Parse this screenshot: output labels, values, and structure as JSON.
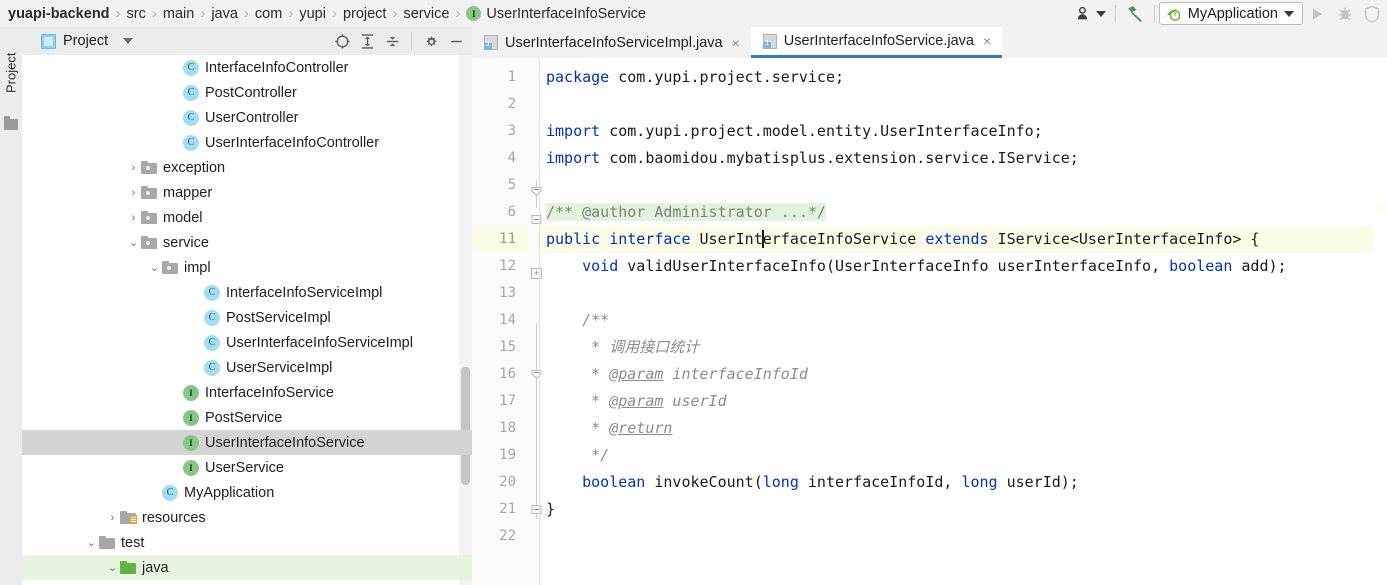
{
  "breadcrumb": {
    "root": "yuapi-backend",
    "items": [
      "src",
      "main",
      "java",
      "com",
      "yupi",
      "project",
      "service"
    ],
    "leaf": {
      "badge": "I",
      "label": "UserInterfaceInfoService"
    },
    "separator": "›"
  },
  "toolbar": {
    "user_icon": "user-icon",
    "build_icon": "hammer-icon",
    "run_config_label": "MyApplication",
    "run_icon": "run-icon",
    "debug_icon": "debug-icon",
    "coverage_icon": "coverage-icon"
  },
  "toolstrip": {
    "label": "Project",
    "folder_icon": "folder-icon"
  },
  "project_panel": {
    "title": "Project",
    "dropdown_icon": "chevron-down-icon",
    "tools": [
      "locate-icon",
      "expand-all-icon",
      "collapse-all-icon",
      "settings-gear-icon",
      "minimize-icon"
    ],
    "tree": [
      {
        "label": "InterfaceInfoController",
        "icon": "class",
        "indent": 7,
        "arrow": "",
        "state": ""
      },
      {
        "label": "PostController",
        "icon": "class",
        "indent": 7,
        "arrow": "",
        "state": ""
      },
      {
        "label": "UserController",
        "icon": "class",
        "indent": 7,
        "arrow": "",
        "state": ""
      },
      {
        "label": "UserInterfaceInfoController",
        "icon": "class",
        "indent": 7,
        "arrow": "",
        "state": ""
      },
      {
        "label": "exception",
        "icon": "folder",
        "indent": 5,
        "arrow": "collapsed",
        "state": ""
      },
      {
        "label": "mapper",
        "icon": "folder",
        "indent": 5,
        "arrow": "collapsed",
        "state": ""
      },
      {
        "label": "model",
        "icon": "folder",
        "indent": 5,
        "arrow": "collapsed",
        "state": ""
      },
      {
        "label": "service",
        "icon": "folder",
        "indent": 5,
        "arrow": "expanded",
        "state": ""
      },
      {
        "label": "impl",
        "icon": "folder",
        "indent": 6,
        "arrow": "expanded",
        "state": ""
      },
      {
        "label": "InterfaceInfoServiceImpl",
        "icon": "class",
        "indent": 8,
        "arrow": "",
        "state": ""
      },
      {
        "label": "PostServiceImpl",
        "icon": "class",
        "indent": 8,
        "arrow": "",
        "state": ""
      },
      {
        "label": "UserInterfaceInfoServiceImpl",
        "icon": "class",
        "indent": 8,
        "arrow": "",
        "state": ""
      },
      {
        "label": "UserServiceImpl",
        "icon": "class",
        "indent": 8,
        "arrow": "",
        "state": ""
      },
      {
        "label": "InterfaceInfoService",
        "icon": "iface",
        "indent": 7,
        "arrow": "",
        "state": ""
      },
      {
        "label": "PostService",
        "icon": "iface",
        "indent": 7,
        "arrow": "",
        "state": ""
      },
      {
        "label": "UserInterfaceInfoService",
        "icon": "iface",
        "indent": 7,
        "arrow": "",
        "state": "selected"
      },
      {
        "label": "UserService",
        "icon": "iface",
        "indent": 7,
        "arrow": "",
        "state": ""
      },
      {
        "label": "MyApplication",
        "icon": "class",
        "indent": 6,
        "arrow": "",
        "state": ""
      },
      {
        "label": "resources",
        "icon": "res",
        "indent": 4,
        "arrow": "collapsed",
        "state": ""
      },
      {
        "label": "test",
        "icon": "plain",
        "indent": 3,
        "arrow": "expanded",
        "state": ""
      },
      {
        "label": "java",
        "icon": "green",
        "indent": 4,
        "arrow": "expanded",
        "state": "green"
      }
    ]
  },
  "editor": {
    "tabs": [
      {
        "label": "UserInterfaceInfoServiceImpl.java",
        "active": false,
        "close": "×"
      },
      {
        "label": "UserInterfaceInfoService.java",
        "active": true,
        "close": "×"
      }
    ],
    "gutter_numbers": [
      "1",
      "2",
      "3",
      "4",
      "5",
      "6",
      "11",
      "12",
      "13",
      "14",
      "15",
      "16",
      "17",
      "18",
      "19",
      "20",
      "21",
      "22"
    ],
    "current_line": "11",
    "lines": [
      {
        "num": "1",
        "html": "<span class=\"kw\">package</span> com.yupi.project.service;"
      },
      {
        "num": "2",
        "html": ""
      },
      {
        "num": "3",
        "html": "<span class=\"kw\">import</span> com.yupi.project.model.entity.UserInterfaceInfo;"
      },
      {
        "num": "4",
        "html": "<span class=\"kw\">import</span> com.baomidou.mybatisplus.extension.service.IService;"
      },
      {
        "num": "5",
        "html": ""
      },
      {
        "num": "6",
        "html": "<span class=\"cmt fold-cmt\">/** @author Administrator ...*/</span>"
      },
      {
        "num": "11",
        "html": "<span class=\"kw\">public</span> <span class=\"kw\">interface</span> UserInt<span class=\"caretbar\"></span>erfaceInfoService <span class=\"kw\">extends</span> IService&lt;UserInterfaceInfo&gt; {",
        "current": true
      },
      {
        "num": "12",
        "html": "    <span class=\"kw\">void</span> validUserInterfaceInfo(UserInterfaceInfo userInterfaceInfo, <span class=\"kw\">boolean</span> add);"
      },
      {
        "num": "13",
        "html": ""
      },
      {
        "num": "14",
        "html": "    <span class=\"cmt\">/**</span>"
      },
      {
        "num": "15",
        "html": "     <span class=\"cmt\">* 调用接口统计</span>"
      },
      {
        "num": "16",
        "html": "     <span class=\"cmt\">* </span><span class=\"tag\">@param</span><span class=\"cmt\"> interfaceInfoId</span>"
      },
      {
        "num": "17",
        "html": "     <span class=\"cmt\">* </span><span class=\"tag\">@param</span><span class=\"cmt\"> userId</span>"
      },
      {
        "num": "18",
        "html": "     <span class=\"cmt\">* </span><span class=\"tag\">@return</span>"
      },
      {
        "num": "19",
        "html": "     <span class=\"cmt\">*/</span>"
      },
      {
        "num": "20",
        "html": "    <span class=\"kw\">boolean</span> invokeCount(<span class=\"kw\">long</span> interfaceInfoId, <span class=\"kw\">long</span> userId);"
      },
      {
        "num": "21",
        "html": "}"
      },
      {
        "num": "22",
        "html": ""
      }
    ],
    "plain_text": {
      "l1": "package com.yupi.project.service;",
      "l3": "import com.yupi.project.model.entity.UserInterfaceInfo;",
      "l4": "import com.baomidou.mybatisplus.extension.service.IService;",
      "l6": "/** @author Administrator ...*/",
      "l11": "public interface UserInterfaceInfoService extends IService<UserInterfaceInfo> {",
      "l12": "void validUserInterfaceInfo(UserInterfaceInfo userInterfaceInfo, boolean add);",
      "l14": "/**",
      "l15": "* 调用接口统计",
      "l16": "* @param interfaceInfoId",
      "l17": "* @param userId",
      "l18": "* @return",
      "l19": "*/",
      "l20": "boolean invokeCount(long interfaceInfoId, long userId);",
      "l21": "}"
    }
  },
  "colors": {
    "keyword": "#0033b3",
    "comment": "#8c8c8c",
    "fold_comment_bg": "#e3f2dc",
    "current_line_bg": "#fcfbe8",
    "selection_bg": "#d4d4d4",
    "green_row_bg": "#e7f4e0",
    "active_tab_underline": "#3d7ab5",
    "class_icon": "#a5dcf0",
    "interface_icon": "#8bc48b"
  }
}
